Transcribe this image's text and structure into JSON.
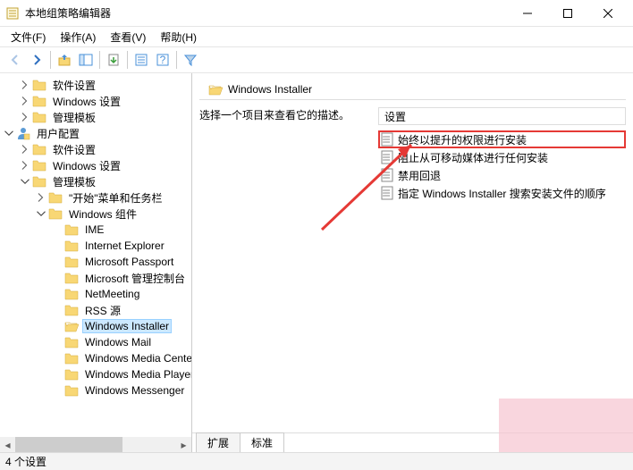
{
  "window": {
    "title": "本地组策略编辑器"
  },
  "menu": {
    "file": "文件(F)",
    "action": "操作(A)",
    "view": "查看(V)",
    "help": "帮助(H)"
  },
  "tree": [
    {
      "level": 1,
      "exp": "closed",
      "icon": "folder",
      "label": "软件设置"
    },
    {
      "level": 1,
      "exp": "closed",
      "icon": "folder",
      "label": "Windows 设置"
    },
    {
      "level": 1,
      "exp": "closed",
      "icon": "folder",
      "label": "管理模板"
    },
    {
      "level": 0,
      "exp": "open",
      "icon": "user",
      "label": "用户配置"
    },
    {
      "level": 1,
      "exp": "closed",
      "icon": "folder",
      "label": "软件设置"
    },
    {
      "level": 1,
      "exp": "closed",
      "icon": "folder",
      "label": "Windows 设置"
    },
    {
      "level": 1,
      "exp": "open",
      "icon": "folder",
      "label": "管理模板"
    },
    {
      "level": 2,
      "exp": "closed",
      "icon": "folder",
      "label": "\"开始\"菜单和任务栏"
    },
    {
      "level": 2,
      "exp": "open",
      "icon": "folder",
      "label": "Windows 组件"
    },
    {
      "level": 3,
      "exp": "none",
      "icon": "folder",
      "label": "IME"
    },
    {
      "level": 3,
      "exp": "none",
      "icon": "folder",
      "label": "Internet Explorer"
    },
    {
      "level": 3,
      "exp": "none",
      "icon": "folder",
      "label": "Microsoft Passport"
    },
    {
      "level": 3,
      "exp": "none",
      "icon": "folder",
      "label": "Microsoft 管理控制台"
    },
    {
      "level": 3,
      "exp": "none",
      "icon": "folder",
      "label": "NetMeeting"
    },
    {
      "level": 3,
      "exp": "none",
      "icon": "folder",
      "label": "RSS 源"
    },
    {
      "level": 3,
      "exp": "none",
      "icon": "folder-open",
      "label": "Windows Installer",
      "selected": true
    },
    {
      "level": 3,
      "exp": "none",
      "icon": "folder",
      "label": "Windows Mail"
    },
    {
      "level": 3,
      "exp": "none",
      "icon": "folder",
      "label": "Windows Media Center"
    },
    {
      "level": 3,
      "exp": "none",
      "icon": "folder",
      "label": "Windows Media Player"
    },
    {
      "level": 3,
      "exp": "none",
      "icon": "folder",
      "label": "Windows Messenger"
    }
  ],
  "content": {
    "heading": "Windows Installer",
    "desc_prompt": "选择一个项目来查看它的描述。",
    "col_settings": "设置",
    "policies": [
      {
        "label": "始终以提升的权限进行安装",
        "highlighted": true
      },
      {
        "label": "阻止从可移动媒体进行任何安装"
      },
      {
        "label": "禁用回退"
      },
      {
        "label": "指定 Windows Installer 搜索安装文件的顺序"
      }
    ]
  },
  "tabs": {
    "extended": "扩展",
    "standard": "标准"
  },
  "status": {
    "count": "4 个设置"
  }
}
